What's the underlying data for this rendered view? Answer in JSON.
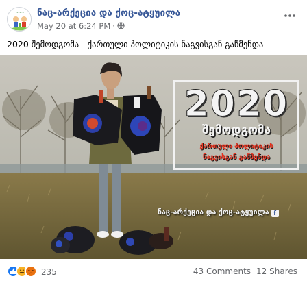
{
  "post": {
    "page_name": "ნაც-არქეცია და ქოც-ატყუილა",
    "timestamp": "May 20 at 6:24 PM",
    "separator": "·",
    "caption": "2020 შემოდგომა - ქართული პოლიტიკის ნაგვისგან გაწმენდა"
  },
  "image_overlay": {
    "year": "2020",
    "season": "შემოდგომა",
    "line1": "ქართული პოლიტიკის",
    "line2": "ნაგვისგან გაწმენდა",
    "watermark": "ნაც-არქეცია და ქოც-ატყუილა",
    "fb_letter": "f"
  },
  "footer": {
    "reaction_count": "235",
    "comments": "43 Comments",
    "shares": "12 Shares"
  },
  "icons": {
    "avatar": "page-logo-icon",
    "privacy": "globe-icon",
    "more": "more-options-icon",
    "reactions": [
      "like-reaction-icon",
      "haha-reaction-icon",
      "angry-reaction-icon"
    ]
  },
  "colors": {
    "page_name": "#385898",
    "meta_text": "#65676b",
    "overlay_red": "#e7331f",
    "like_blue": "#1877f2"
  }
}
